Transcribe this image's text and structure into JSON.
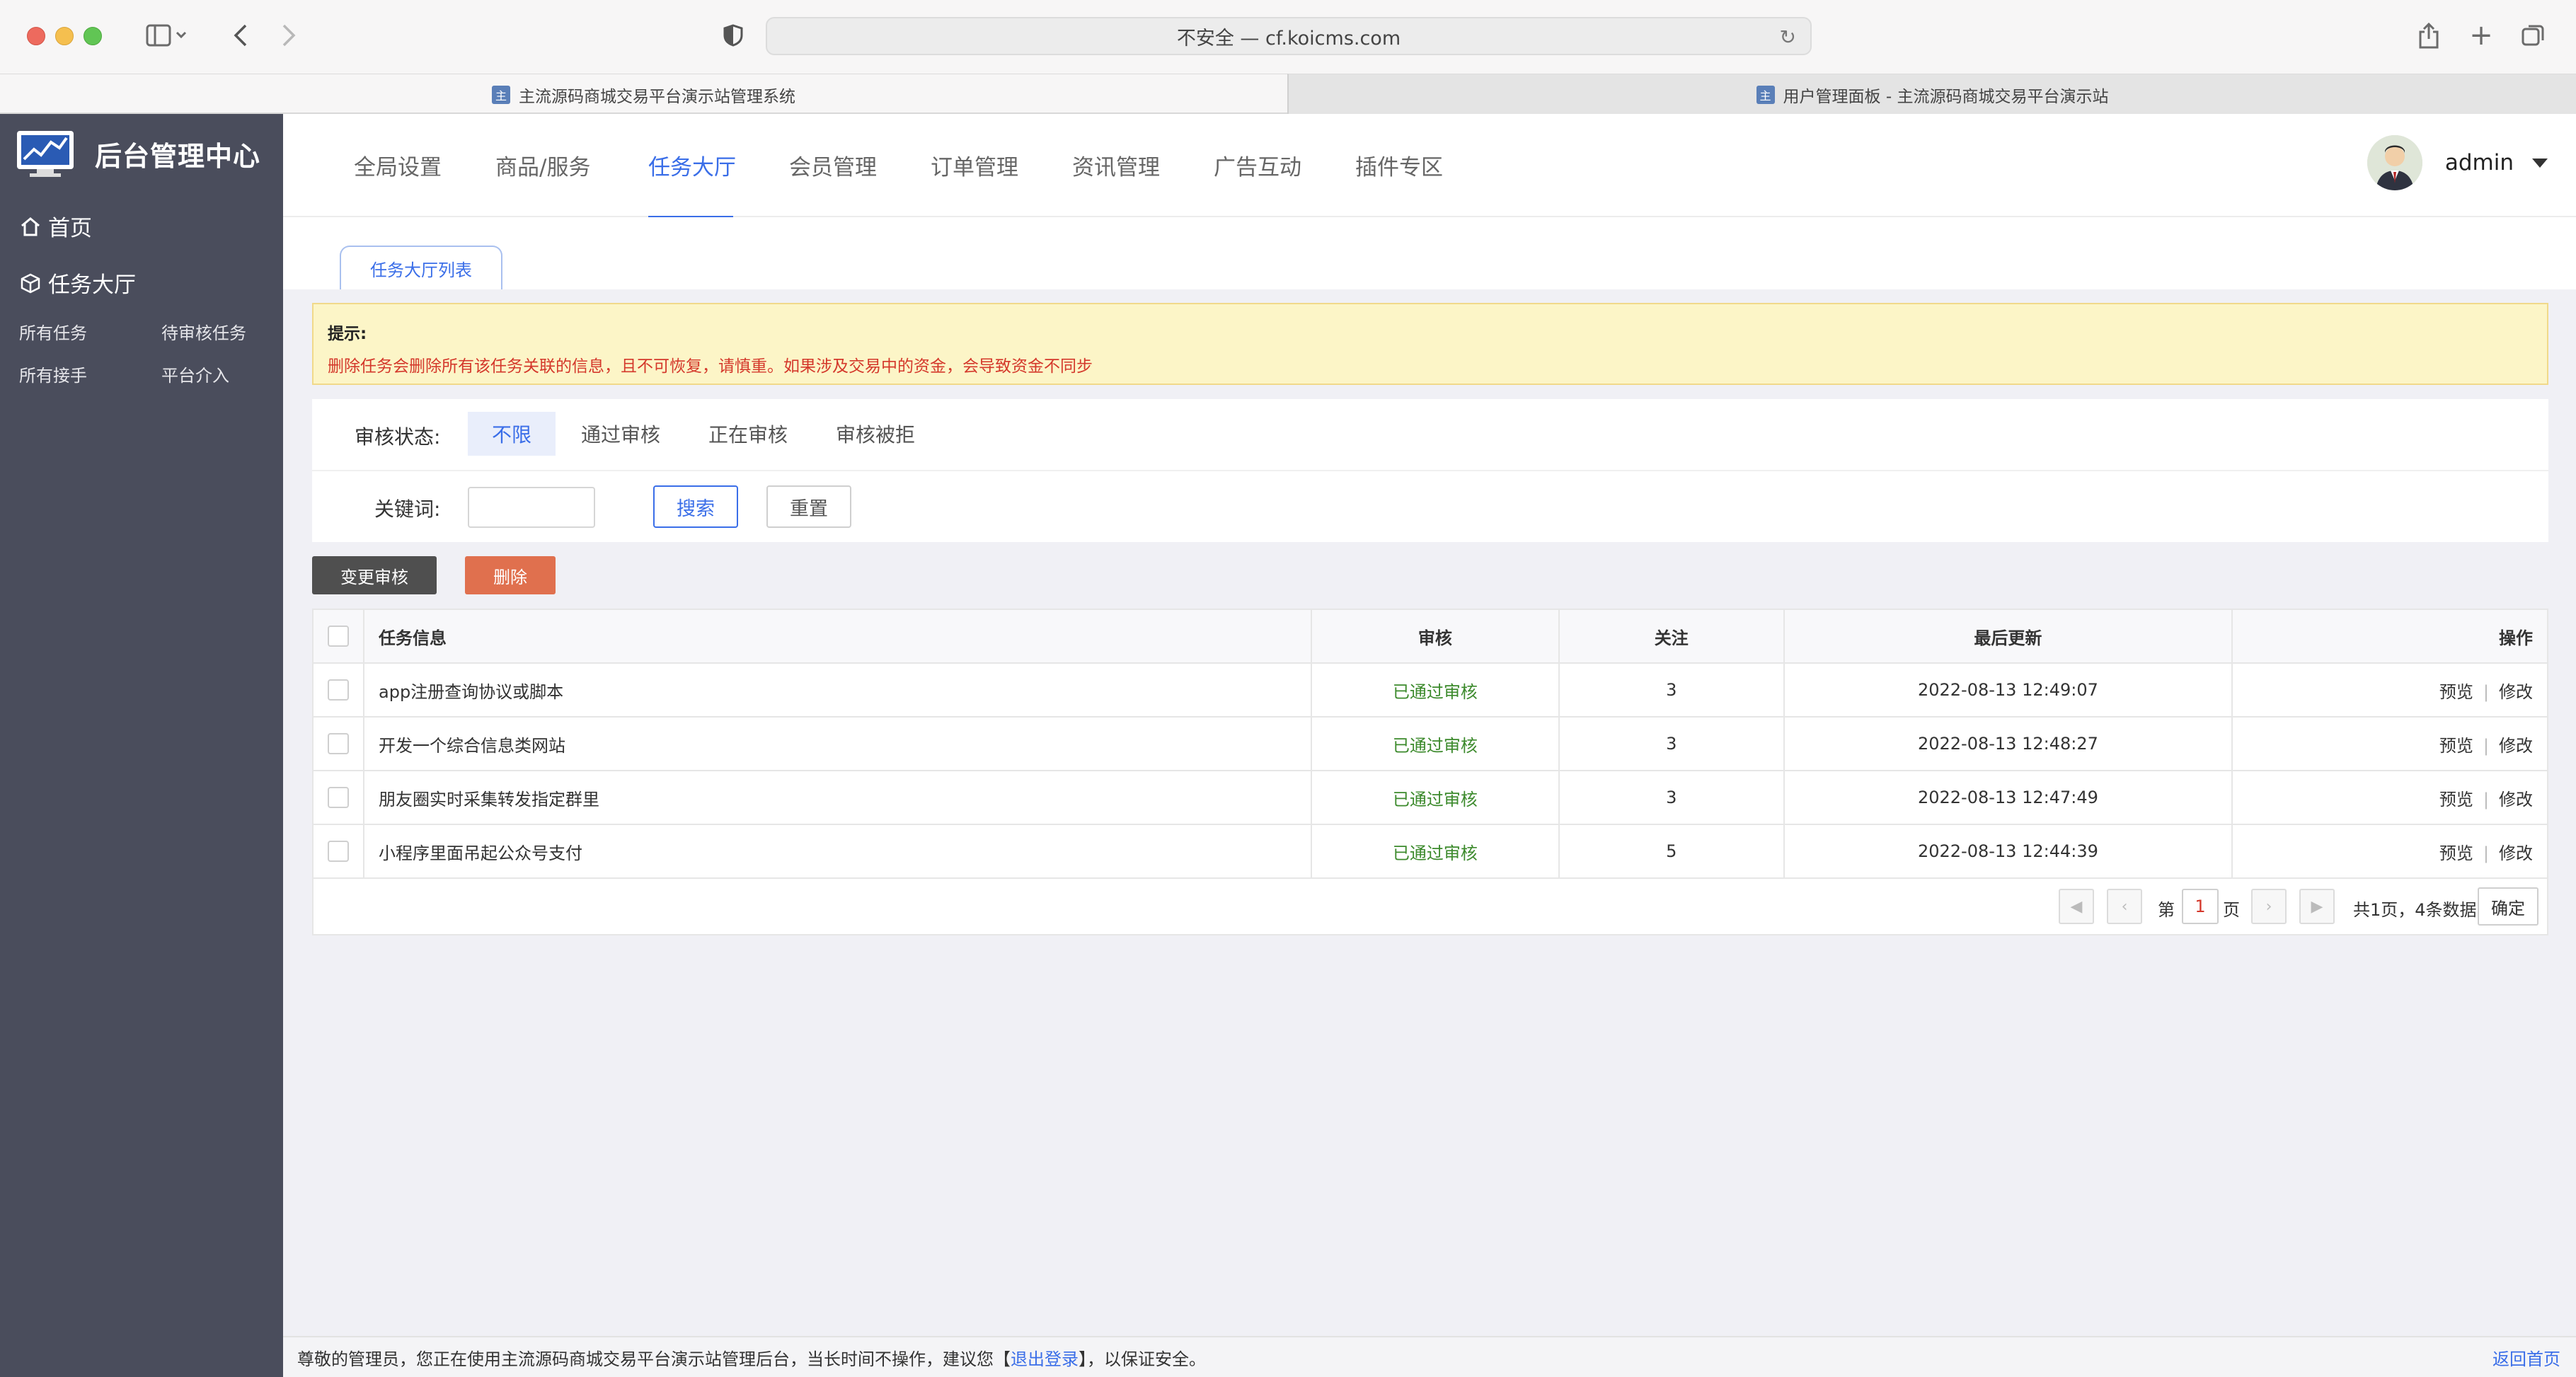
{
  "browser": {
    "url": "不安全 — cf.koicms.com",
    "tabs": [
      {
        "label": "主流源码商城交易平台演示站管理系统"
      },
      {
        "label": "用户管理面板 - 主流源码商城交易平台演示站"
      }
    ]
  },
  "sidebar": {
    "title": "后台管理中心",
    "home": "首页",
    "section": "任务大厅",
    "items": [
      "所有任务",
      "待审核任务",
      "所有接手",
      "平台介入"
    ]
  },
  "topnav": {
    "items": [
      "全局设置",
      "商品/服务",
      "任务大厅",
      "会员管理",
      "订单管理",
      "资讯管理",
      "广告互动",
      "插件专区"
    ],
    "active": "任务大厅",
    "user": "admin"
  },
  "subtab": "任务大厅列表",
  "notice": {
    "title": "提示:",
    "text": "删除任务会删除所有该任务关联的信息，且不可恢复，请慎重。如果涉及交易中的资金，会导致资金不同步"
  },
  "filter": {
    "status_label": "审核状态:",
    "status_options": [
      "不限",
      "通过审核",
      "正在审核",
      "审核被拒"
    ],
    "status_selected": "不限",
    "keyword_label": "关键词:",
    "keyword_value": "",
    "search_btn": "搜索",
    "reset_btn": "重置"
  },
  "actions": {
    "audit": "变更审核",
    "delete": "删除"
  },
  "table": {
    "headers": [
      "任务信息",
      "审核",
      "关注",
      "最后更新",
      "操作"
    ],
    "rows": [
      {
        "title": "app注册查询协议或脚本",
        "status": "已通过审核",
        "follows": "3",
        "updated": "2022-08-13 12:49:07",
        "preview": "预览",
        "edit": "修改"
      },
      {
        "title": "开发一个综合信息类网站",
        "status": "已通过审核",
        "follows": "3",
        "updated": "2022-08-13 12:48:27",
        "preview": "预览",
        "edit": "修改"
      },
      {
        "title": "朋友圈实时采集转发指定群里",
        "status": "已通过审核",
        "follows": "3",
        "updated": "2022-08-13 12:47:49",
        "preview": "预览",
        "edit": "修改"
      },
      {
        "title": "小程序里面吊起公众号支付",
        "status": "已通过审核",
        "follows": "5",
        "updated": "2022-08-13 12:44:39",
        "preview": "预览",
        "edit": "修改"
      }
    ]
  },
  "pager": {
    "page_prefix": "第",
    "page": "1",
    "page_suffix": "页",
    "summary": "共1页，4条数据",
    "ok": "确定"
  },
  "footer": {
    "text_before": "尊敬的管理员，您正在使用主流源码商城交易平台演示站管理后台，当长时间不操作，建议您【",
    "logout": "退出登录",
    "text_after": "】，以保证安全。",
    "home": "返回首页"
  }
}
